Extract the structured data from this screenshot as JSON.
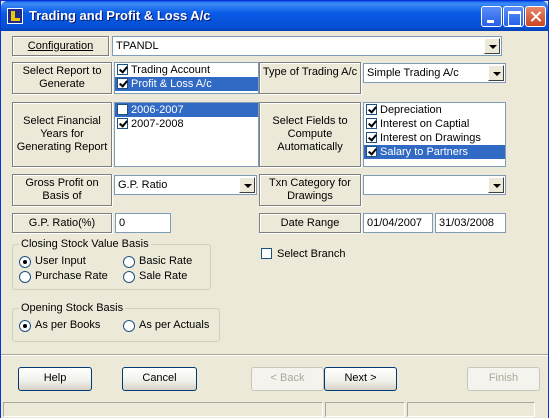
{
  "window": {
    "title": "Trading and Profit & Loss A/c"
  },
  "configuration": {
    "label": "Configuration",
    "value": "TPANDL"
  },
  "select_report": {
    "label": "Select Report to Generate",
    "items": [
      {
        "label": "Trading Account",
        "checked": true,
        "selected": false
      },
      {
        "label": "Profit & Loss A/c",
        "checked": true,
        "selected": true
      }
    ]
  },
  "trading_type": {
    "label": "Type of Trading A/c",
    "value": "Simple Trading A/c"
  },
  "financial_years": {
    "label": "Select Financial Years for Generating Report",
    "items": [
      {
        "label": "2006-2007",
        "checked": false,
        "selected": true
      },
      {
        "label": "2007-2008",
        "checked": true,
        "selected": false
      }
    ]
  },
  "compute_fields": {
    "label": "Select Fields to Compute Automatically",
    "items": [
      {
        "label": "Depreciation",
        "checked": true,
        "selected": false
      },
      {
        "label": "Interest on Captial",
        "checked": true,
        "selected": false
      },
      {
        "label": "Interest on Drawings",
        "checked": true,
        "selected": false
      },
      {
        "label": "Salary to Partners",
        "checked": true,
        "selected": true
      }
    ]
  },
  "gross_profit": {
    "label": "Gross Profit on Basis of",
    "value": "G.P. Ratio"
  },
  "txn_category": {
    "label": "Txn Category for Drawings",
    "value": ""
  },
  "gp_ratio": {
    "label": "G.P. Ratio(%)",
    "value": "0"
  },
  "date_range": {
    "label": "Date Range",
    "from": "01/04/2007",
    "to": "31/03/2008"
  },
  "select_branch": {
    "label": "Select Branch",
    "checked": false
  },
  "closing_stock": {
    "title": "Closing Stock Value Basis",
    "options": [
      {
        "label": "User Input",
        "selected": true
      },
      {
        "label": "Basic Rate",
        "selected": false
      },
      {
        "label": "Purchase Rate",
        "selected": false
      },
      {
        "label": "Sale Rate",
        "selected": false
      }
    ]
  },
  "opening_stock": {
    "title": "Opening Stock Basis",
    "options": [
      {
        "label": "As per Books",
        "selected": true
      },
      {
        "label": "As per Actuals",
        "selected": false
      }
    ]
  },
  "buttons": {
    "help": "Help",
    "cancel": "Cancel",
    "back": "< Back",
    "next": "Next >",
    "finish": "Finish"
  }
}
